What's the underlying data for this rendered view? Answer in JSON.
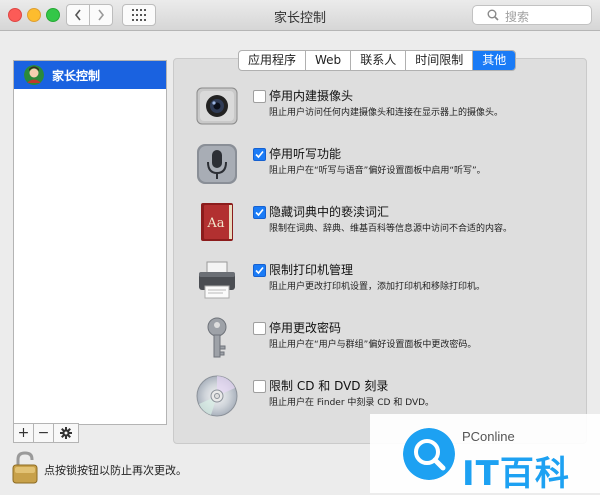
{
  "window": {
    "title": "家长控制"
  },
  "search": {
    "placeholder": "搜索"
  },
  "sidebar": {
    "items": [
      {
        "label": "家长控制"
      }
    ]
  },
  "tabs": [
    {
      "label": "应用程序",
      "active": false
    },
    {
      "label": "Web",
      "active": false
    },
    {
      "label": "联系人",
      "active": false
    },
    {
      "label": "时间限制",
      "active": false
    },
    {
      "label": "其他",
      "active": true
    }
  ],
  "options": [
    {
      "label": "停用内建摄像头",
      "desc": "阻止用户访问任何内建摄像头和连接在显示器上的摄像头。",
      "checked": false,
      "icon": "camera-icon"
    },
    {
      "label": "停用听写功能",
      "desc": "阻止用户在“听写与语音”偏好设置面板中启用“听写”。",
      "checked": true,
      "icon": "microphone-icon"
    },
    {
      "label": "隐藏词典中的亵渎词汇",
      "desc": "限制在词典、辞典、维基百科等信息源中访问不合适的内容。",
      "checked": true,
      "icon": "dictionary-icon"
    },
    {
      "label": "限制打印机管理",
      "desc": "阻止用户更改打印机设置，添加打印机和移除打印机。",
      "checked": true,
      "icon": "printer-icon"
    },
    {
      "label": "停用更改密码",
      "desc": "阻止用户在“用户与群组”偏好设置面板中更改密码。",
      "checked": false,
      "icon": "key-icon"
    },
    {
      "label": "限制 CD 和 DVD 刻录",
      "desc": "阻止用户在 Finder 中刻录 CD 和 DVD。",
      "checked": false,
      "icon": "disc-icon"
    }
  ],
  "toolbar": {
    "add_label": "+",
    "remove_label": "−"
  },
  "lock": {
    "text": "点按锁按钮以防止再次更改。"
  },
  "watermark": {
    "small": "PConline",
    "big": "IT百科"
  }
}
